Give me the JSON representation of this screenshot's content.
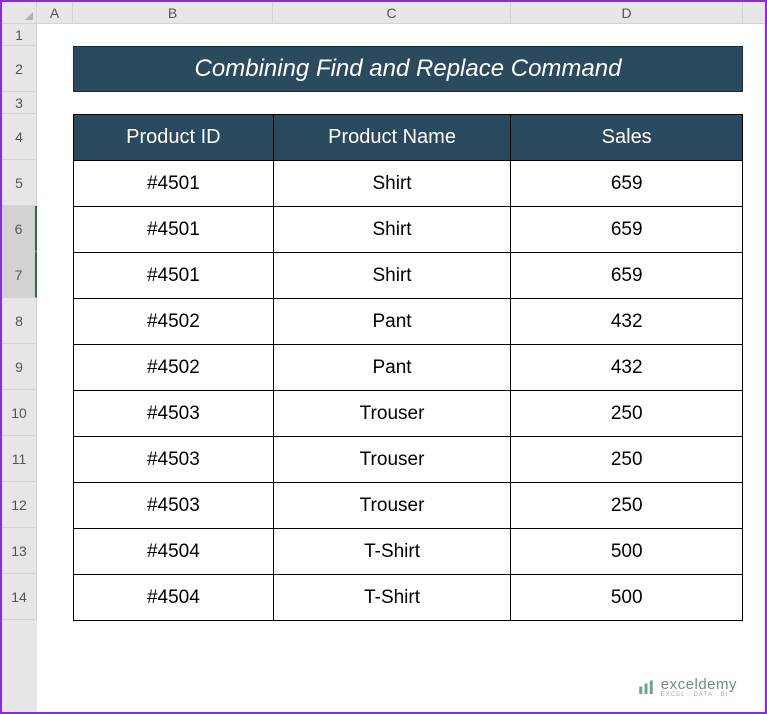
{
  "columns": [
    "A",
    "B",
    "C",
    "D"
  ],
  "rows": [
    "1",
    "2",
    "3",
    "4",
    "5",
    "6",
    "7",
    "8",
    "9",
    "10",
    "11",
    "12",
    "13",
    "14"
  ],
  "selected_rows": [
    6,
    7
  ],
  "title": "Combining Find and Replace Command",
  "table": {
    "headers": {
      "id": "Product ID",
      "name": "Product Name",
      "sales": "Sales"
    },
    "rows": [
      {
        "id": "#4501",
        "name": "Shirt",
        "sales": "659"
      },
      {
        "id": "#4501",
        "name": "Shirt",
        "sales": "659"
      },
      {
        "id": "#4501",
        "name": "Shirt",
        "sales": "659"
      },
      {
        "id": "#4502",
        "name": "Pant",
        "sales": "432"
      },
      {
        "id": "#4502",
        "name": "Pant",
        "sales": "432"
      },
      {
        "id": "#4503",
        "name": "Trouser",
        "sales": "250"
      },
      {
        "id": "#4503",
        "name": "Trouser",
        "sales": "250"
      },
      {
        "id": "#4503",
        "name": "Trouser",
        "sales": "250"
      },
      {
        "id": "#4504",
        "name": "T-Shirt",
        "sales": "500"
      },
      {
        "id": "#4504",
        "name": "T-Shirt",
        "sales": "500"
      }
    ]
  },
  "watermark": {
    "brand": "exceldemy",
    "tagline": "EXCEL · DATA · BI"
  },
  "colors": {
    "banner_bg": "#2a4a5e",
    "banner_fg": "#ffffff"
  }
}
